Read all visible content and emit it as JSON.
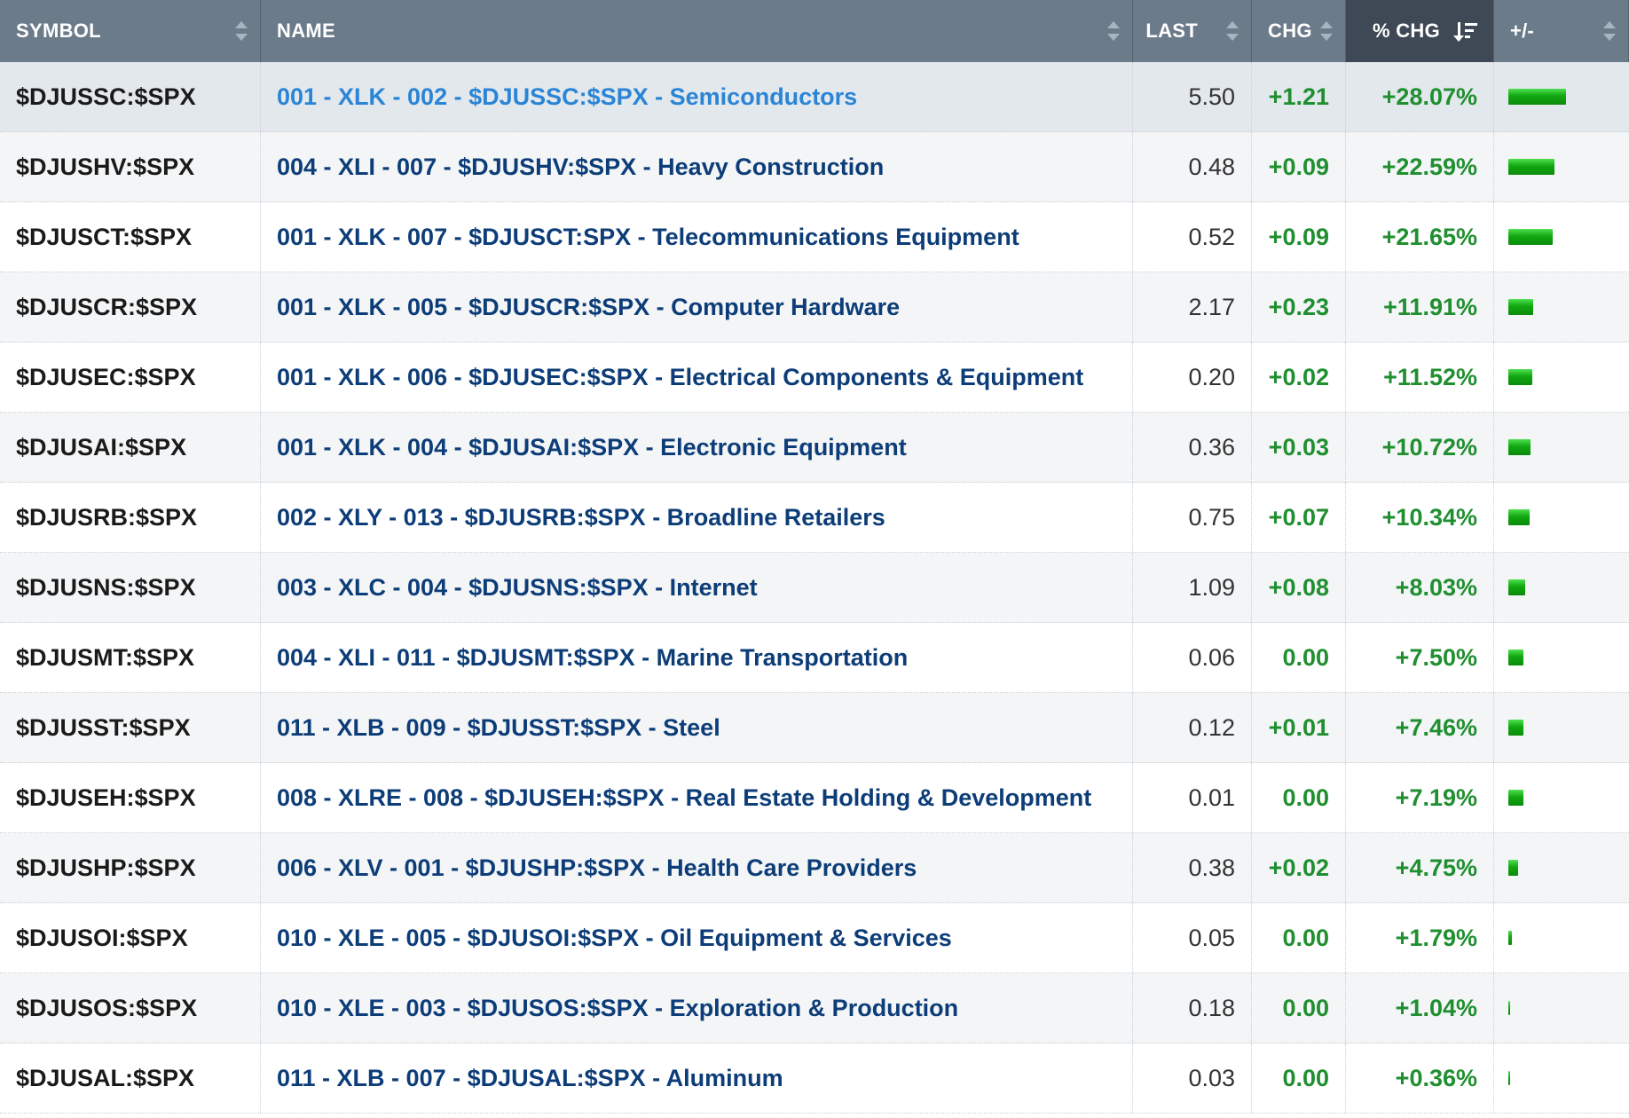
{
  "header": {
    "symbol": "SYMBOL",
    "name": "NAME",
    "last": "LAST",
    "chg": "CHG",
    "pct_chg": "% CHG",
    "plus_minus": "+/-"
  },
  "bar_color": "#11a811",
  "rows": [
    {
      "symbol": "$DJUSSC:$SPX",
      "name": "001 - XLK - 002 - $DJUSSC:$SPX - Semiconductors",
      "last": "5.50",
      "chg": "+1.21",
      "pct": "+28.07%",
      "pct_value": 28.07
    },
    {
      "symbol": "$DJUSHV:$SPX",
      "name": "004 - XLI - 007 - $DJUSHV:$SPX - Heavy Construction",
      "last": "0.48",
      "chg": "+0.09",
      "pct": "+22.59%",
      "pct_value": 22.59
    },
    {
      "symbol": "$DJUSCT:$SPX",
      "name": "001 - XLK - 007 - $DJUSCT:SPX - Telecommunications Equipment",
      "last": "0.52",
      "chg": "+0.09",
      "pct": "+21.65%",
      "pct_value": 21.65
    },
    {
      "symbol": "$DJUSCR:$SPX",
      "name": "001 - XLK - 005 - $DJUSCR:$SPX - Computer Hardware",
      "last": "2.17",
      "chg": "+0.23",
      "pct": "+11.91%",
      "pct_value": 11.91
    },
    {
      "symbol": "$DJUSEC:$SPX",
      "name": "001 - XLK - 006 - $DJUSEC:$SPX - Electrical Components & Equipment",
      "last": "0.20",
      "chg": "+0.02",
      "pct": "+11.52%",
      "pct_value": 11.52
    },
    {
      "symbol": "$DJUSAI:$SPX",
      "name": "001 - XLK - 004 - $DJUSAI:$SPX - Electronic Equipment",
      "last": "0.36",
      "chg": "+0.03",
      "pct": "+10.72%",
      "pct_value": 10.72
    },
    {
      "symbol": "$DJUSRB:$SPX",
      "name": "002 - XLY - 013 - $DJUSRB:$SPX - Broadline Retailers",
      "last": "0.75",
      "chg": "+0.07",
      "pct": "+10.34%",
      "pct_value": 10.34
    },
    {
      "symbol": "$DJUSNS:$SPX",
      "name": "003 - XLC - 004 - $DJUSNS:$SPX - Internet",
      "last": "1.09",
      "chg": "+0.08",
      "pct": "+8.03%",
      "pct_value": 8.03
    },
    {
      "symbol": "$DJUSMT:$SPX",
      "name": "004 - XLI - 011 - $DJUSMT:$SPX - Marine Transportation",
      "last": "0.06",
      "chg": "0.00",
      "pct": "+7.50%",
      "pct_value": 7.5
    },
    {
      "symbol": "$DJUSST:$SPX",
      "name": "011 - XLB - 009 - $DJUSST:$SPX - Steel",
      "last": "0.12",
      "chg": "+0.01",
      "pct": "+7.46%",
      "pct_value": 7.46
    },
    {
      "symbol": "$DJUSEH:$SPX",
      "name": "008 - XLRE - 008 - $DJUSEH:$SPX - Real Estate Holding & Development",
      "last": "0.01",
      "chg": "0.00",
      "pct": "+7.19%",
      "pct_value": 7.19
    },
    {
      "symbol": "$DJUSHP:$SPX",
      "name": "006 - XLV - 001 - $DJUSHP:$SPX - Health Care Providers",
      "last": "0.38",
      "chg": "+0.02",
      "pct": "+4.75%",
      "pct_value": 4.75
    },
    {
      "symbol": "$DJUSOI:$SPX",
      "name": "010 - XLE - 005 - $DJUSOI:$SPX - Oil Equipment & Services",
      "last": "0.05",
      "chg": "0.00",
      "pct": "+1.79%",
      "pct_value": 1.79
    },
    {
      "symbol": "$DJUSOS:$SPX",
      "name": "010 - XLE - 003 - $DJUSOS:$SPX - Exploration & Production",
      "last": "0.18",
      "chg": "0.00",
      "pct": "+1.04%",
      "pct_value": 1.04
    },
    {
      "symbol": "$DJUSAL:$SPX",
      "name": "011 - XLB - 007 - $DJUSAL:$SPX - Aluminum",
      "last": "0.03",
      "chg": "0.00",
      "pct": "+0.36%",
      "pct_value": 0.36
    }
  ]
}
